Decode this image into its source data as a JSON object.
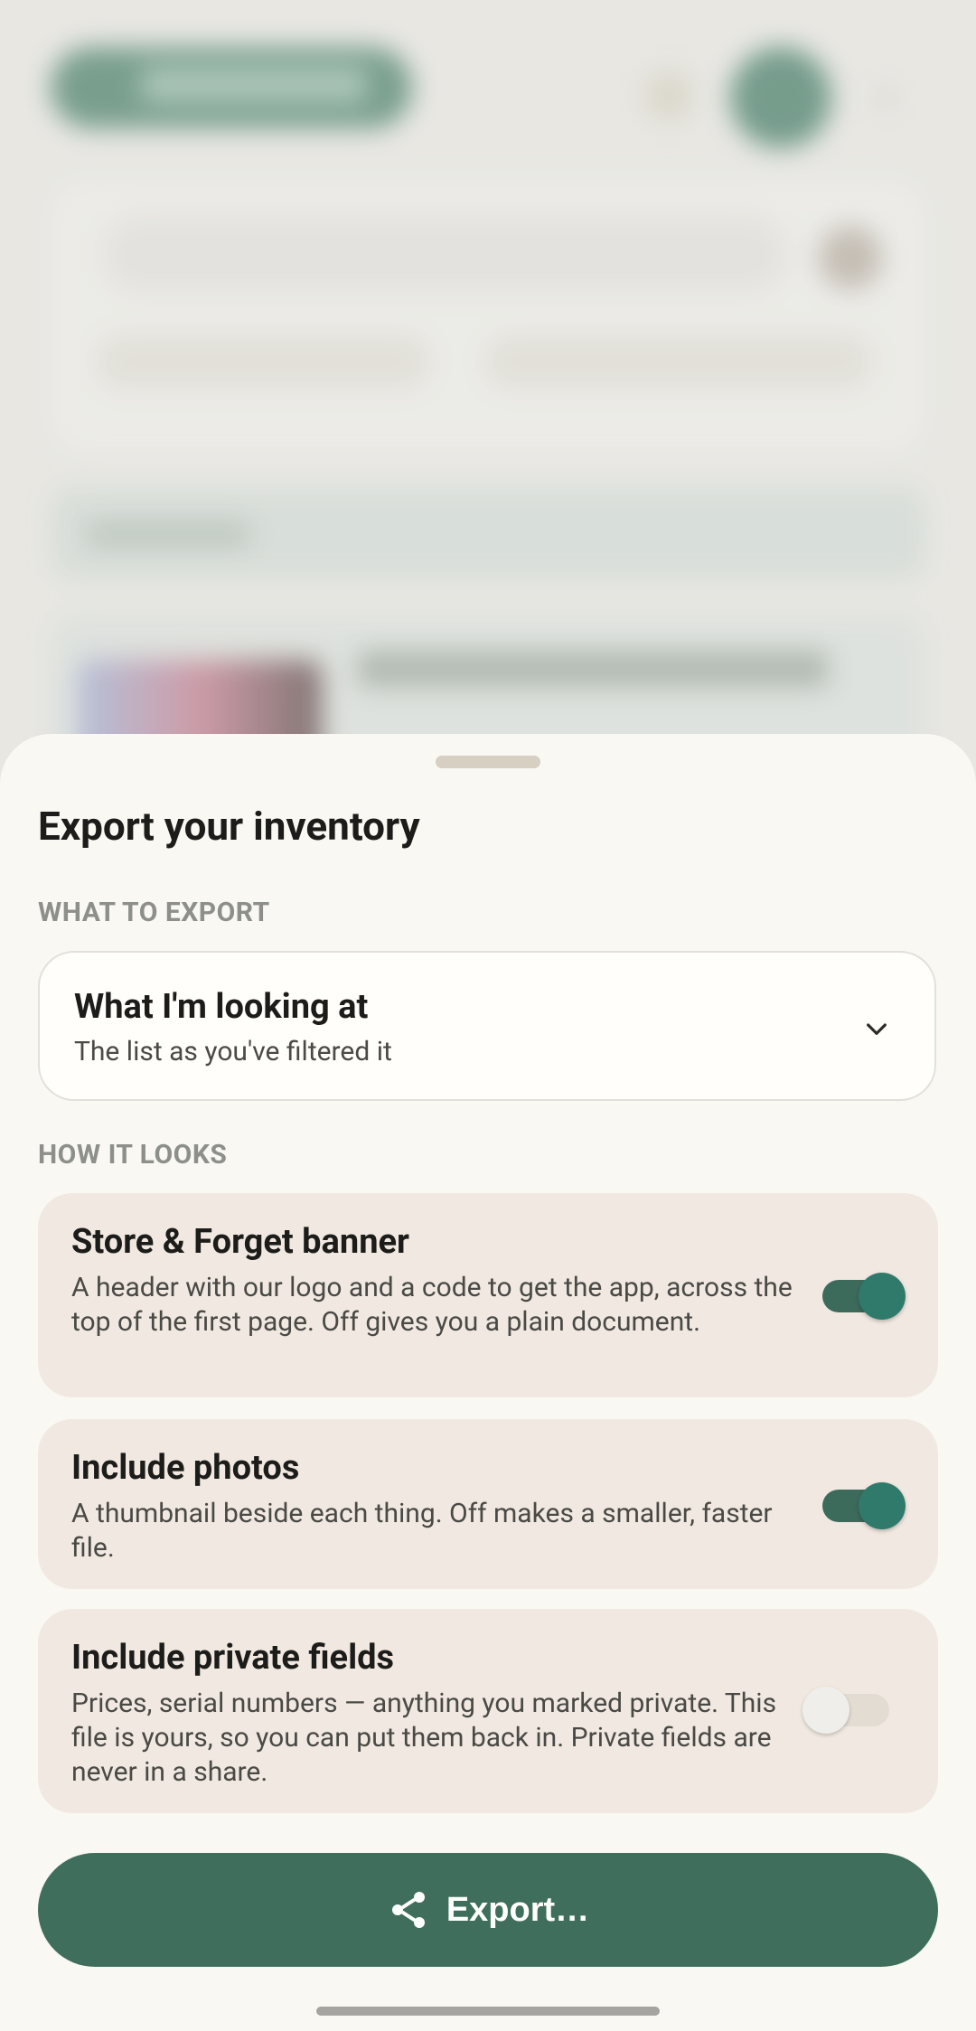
{
  "sheet": {
    "title": "Export your inventory",
    "what_label": "WHAT TO EXPORT",
    "how_label": "HOW IT LOOKS"
  },
  "scope": {
    "selected_title": "What I'm looking at",
    "selected_sub": "The list as you've filtered it"
  },
  "options": [
    {
      "title": "Store & Forget banner",
      "desc": "A header with our logo and a code to get the app, across the top of the first page. Off gives you a plain document.",
      "enabled": true
    },
    {
      "title": "Include photos",
      "desc": "A thumbnail beside each thing. Off makes a smaller, faster file.",
      "enabled": true
    },
    {
      "title": "Include private fields",
      "desc": "Prices, serial numbers — anything you marked private. This file is yours, so you can put them back in. Private fields are never in a share.",
      "enabled": false
    }
  ],
  "export_button": {
    "label": "Export…",
    "icon": "share-icon"
  },
  "colors": {
    "accent": "#3f6e5d",
    "toggle_on": "#2f7a6b",
    "sheet_bg": "#faf8f3",
    "option_bg": "#f1e9e1"
  }
}
